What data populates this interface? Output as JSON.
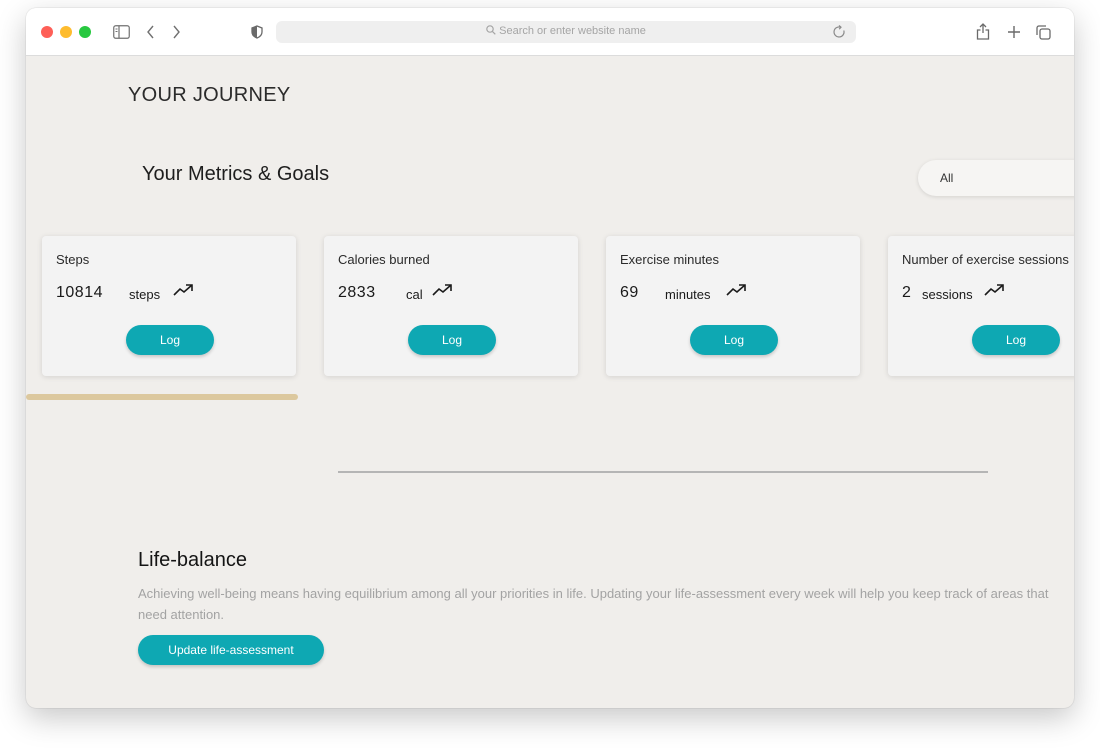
{
  "browser": {
    "search_placeholder": "Search or enter website name"
  },
  "page": {
    "journey_title": "YOUR JOURNEY",
    "metrics_title": "Your Metrics & Goals",
    "filter_selected": "All"
  },
  "metrics": [
    {
      "title": "Steps",
      "value": "10814",
      "unit": "steps",
      "button": "Log"
    },
    {
      "title": "Calories burned",
      "value": "2833",
      "unit": "cal",
      "button": "Log"
    },
    {
      "title": "Exercise minutes",
      "value": "69",
      "unit": "minutes",
      "button": "Log"
    },
    {
      "title": "Number of exercise sessions",
      "value": "2",
      "unit": "sessions",
      "button": "Log"
    }
  ],
  "life_balance": {
    "title": "Life-balance",
    "description": "Achieving well-being means having equilibrium among all your priorities in life. Updating your life-assessment every week will help you keep track of areas that need attention.",
    "button": "Update life-assessment"
  },
  "colors": {
    "accent": "#0ea8b3",
    "progress": "#dcc89e",
    "background": "#f0eeeb"
  }
}
